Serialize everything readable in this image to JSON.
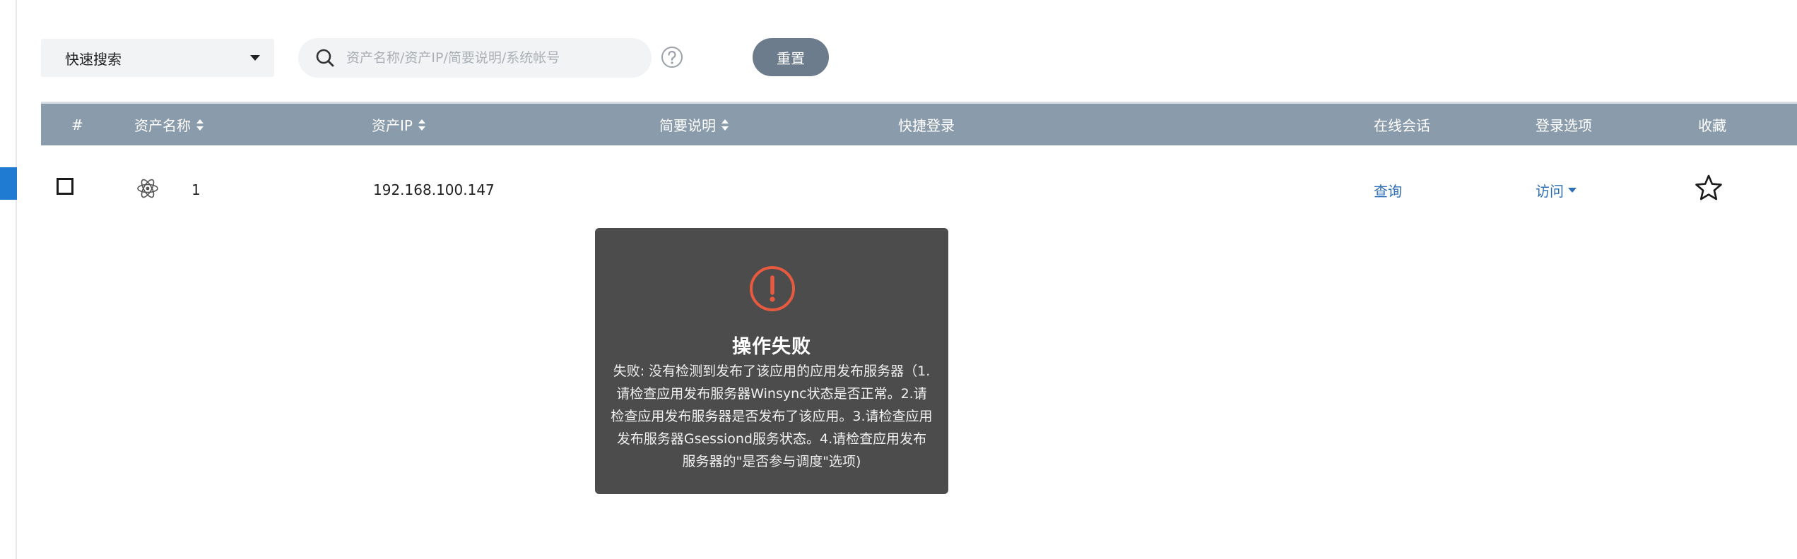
{
  "toolbar": {
    "quick_search_label": "快速搜索",
    "search_placeholder": "资产名称/资产IP/简要说明/系统帐号",
    "reset_label": "重置"
  },
  "table": {
    "columns": {
      "index": "#",
      "name": "资产名称",
      "ip": "资产IP",
      "desc": "简要说明",
      "quick_login": "快捷登录",
      "online_session": "在线会话",
      "login_options": "登录选项",
      "favorite": "收藏"
    },
    "rows": [
      {
        "name": "1",
        "ip": "192.168.100.147",
        "online_session_link": "查询",
        "login_option_link": "访问"
      }
    ]
  },
  "toast": {
    "title": "操作失败",
    "message": "失败: 没有检测到发布了该应用的应用发布服务器（1.请检查应用发布服务器Winsync状态是否正常。2.请检查应用发布服务器是否发布了该应用。3.请检查应用发布服务器Gsessiond服务状态。4.请检查应用发布服务器的\"是否参与调度\"选项)"
  },
  "colors": {
    "header_bg": "#8a9bab",
    "reset_bg": "#6c7c8d",
    "link": "#2d6fb7",
    "toast_bg": "#4c4c4c",
    "alert": "#e85a3f",
    "accent": "#1f7ad1"
  },
  "icons": {
    "search": "search-icon",
    "help": "question-circle-icon",
    "asset": "atom-icon",
    "favorite": "star-outline-icon",
    "alert": "exclamation-circle-icon"
  }
}
